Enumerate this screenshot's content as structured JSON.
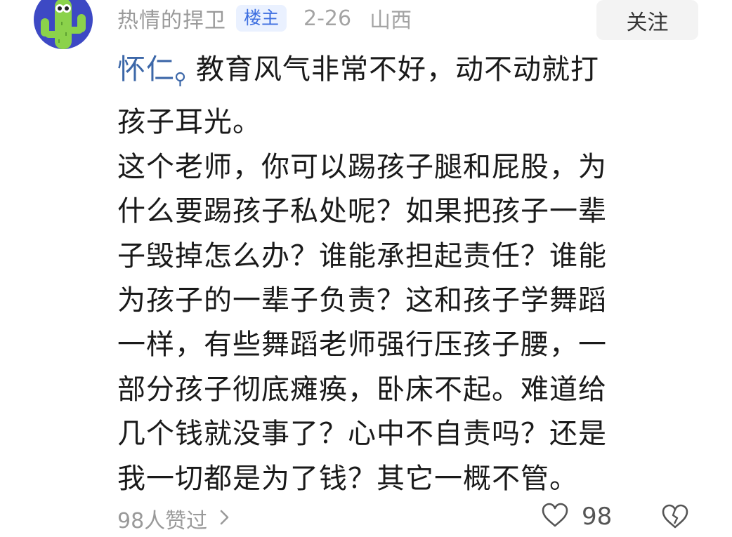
{
  "user": {
    "name": "热情的捍卫",
    "op_badge": "楼主",
    "date": "2-26",
    "location": "山西",
    "avatar_icon": "cactus-avatar-icon",
    "avatar_bg": "#3d49c4"
  },
  "follow_label": "关注",
  "comment": {
    "mention_name": "怀仁",
    "mention_icon": "search-icon",
    "mention_color": "#3c67a8",
    "line1": "教育风气非常不好，动不动就打",
    "line2": "孩子耳光。",
    "body_lines": [
      "这个老师，你可以踢孩子腿和屁股，为",
      "什么要踢孩子私处呢？如果把孩子一辈",
      "子毁掉怎么办？谁能承担起责任？谁能",
      "为孩子的一辈子负责？这和孩子学舞蹈",
      "一样，有些舞蹈老师强行压孩子腰，一",
      "部分孩子彻底瘫痪，卧床不起。难道给",
      "几个钱就没事了？心中不自责吗？还是",
      "我一切都是为了钱？其它一概不管。"
    ]
  },
  "footer": {
    "likes_summary": "98人赞过",
    "like_count": "98",
    "like_icon": "heart-icon",
    "dislike_icon": "broken-heart-icon",
    "chevron_icon": "chevron-right-icon"
  }
}
